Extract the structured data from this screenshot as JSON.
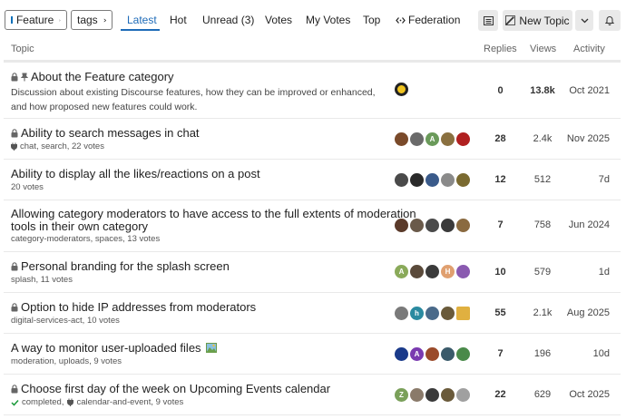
{
  "nav": {
    "category_label": "Feature",
    "tags_label": "tags",
    "tabs": [
      "Latest",
      "Hot",
      "Unread (3)",
      "Votes",
      "My Votes",
      "Top",
      "Federation"
    ],
    "new_topic_label": "New Topic"
  },
  "headers": {
    "topic": "Topic",
    "replies": "Replies",
    "views": "Views",
    "activity": "Activity"
  },
  "topics": [
    {
      "title": "About the Feature category",
      "excerpt": "Discussion about existing Discourse features, how they can be improved or enhanced, and how proposed new features could work.",
      "replies": "0",
      "views": "13.8k",
      "activity": "Oct 2021"
    },
    {
      "title": "Ability to search messages in chat",
      "sub": "chat, search, 22 votes",
      "replies": "28",
      "views": "2.4k",
      "activity": "Nov 2025"
    },
    {
      "title": "Ability to display all the likes/reactions on a post",
      "sub": "20 votes",
      "replies": "12",
      "views": "512",
      "activity": "7d"
    },
    {
      "title_line1": "Allowing category moderators to have access to the full extents of moderation",
      "title_line2": "tools in their own category",
      "sub": "category-moderators, spaces, 13 votes",
      "replies": "7",
      "views": "758",
      "activity": "Jun 2024"
    },
    {
      "title": "Personal branding for the splash screen",
      "sub": "splash, 11 votes",
      "replies": "10",
      "views": "579",
      "activity": "1d"
    },
    {
      "title": "Option to hide IP addresses from moderators",
      "sub": "digital-services-act, 10 votes",
      "replies": "55",
      "views": "2.1k",
      "activity": "Aug 2025"
    },
    {
      "title": "A way to monitor user-uploaded files",
      "sub": "moderation, uploads, 9 votes",
      "replies": "7",
      "views": "196",
      "activity": "10d"
    },
    {
      "title": "Choose first day of the week on Upcoming Events calendar",
      "sub_completed": "completed,",
      "sub": "calendar-and-event, 9 votes",
      "replies": "22",
      "views": "629",
      "activity": "Oct 2025"
    }
  ],
  "avatar_letters": [
    "A",
    "A",
    "H",
    "h",
    "A",
    "Z"
  ],
  "colors": {
    "accent": "#1e6bb8",
    "category_square": "#0a6fb8",
    "completed_check": "#1a9a3a"
  }
}
